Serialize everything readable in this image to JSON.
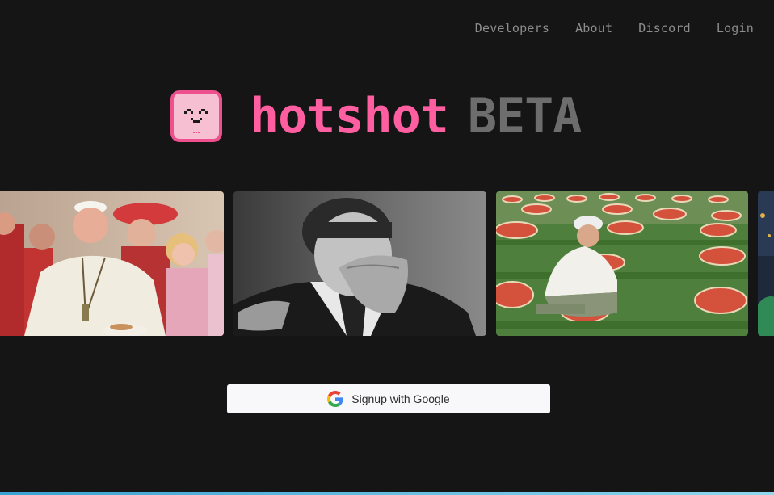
{
  "nav": {
    "items": [
      {
        "label": "Developers"
      },
      {
        "label": "About"
      },
      {
        "label": "Discord"
      },
      {
        "label": "Login"
      }
    ]
  },
  "brand": {
    "name": "hotshot",
    "tag": "BETA",
    "icon": "smiling-face-logo-icon"
  },
  "carousel": {
    "images": [
      {
        "subject": "pope-with-people-image"
      },
      {
        "subject": "man-crying-black-and-white-image"
      },
      {
        "subject": "pizza-field-image"
      },
      {
        "subject": "partial-image"
      }
    ]
  },
  "signup": {
    "label": "Signup with Google",
    "icon": "google-icon"
  },
  "colors": {
    "background": "#161516",
    "brand_pink": "#ff5fa0",
    "beta_gray": "#6d6d6d",
    "nav_text": "#8d8d8d",
    "button_bg": "#f8f8fa"
  }
}
